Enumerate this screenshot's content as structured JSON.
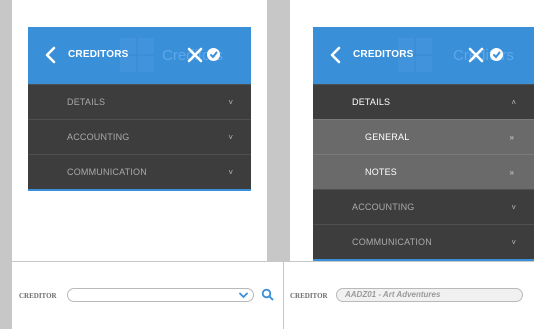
{
  "left_menu": {
    "title": "CREDITORS",
    "ghost_title": "Creditors",
    "items": [
      {
        "label": "DETAILS",
        "chevron": "˅"
      },
      {
        "label": "ACCOUNTING",
        "chevron": "˅"
      },
      {
        "label": "COMMUNICATION",
        "chevron": "˅"
      }
    ]
  },
  "right_menu": {
    "title": "CREDITORS",
    "ghost_title": "Creditors",
    "details": {
      "label": "DETAILS",
      "chevron": "˄"
    },
    "sub_items": [
      {
        "label": "GENERAL",
        "chevron": "»"
      },
      {
        "label": "NOTES",
        "chevron": "»"
      }
    ],
    "items": [
      {
        "label": "ACCOUNTING",
        "chevron": "˅"
      },
      {
        "label": "COMMUNICATION",
        "chevron": "˅"
      }
    ]
  },
  "left_field": {
    "label": "CREDITOR",
    "value": ""
  },
  "right_field": {
    "label": "CREDITOR",
    "value": "AADZ01 - Art Adventures"
  },
  "colors": {
    "accent": "#3a8fd9",
    "menu_dark": "#3d3d3d",
    "submenu": "#6a6a6a"
  }
}
